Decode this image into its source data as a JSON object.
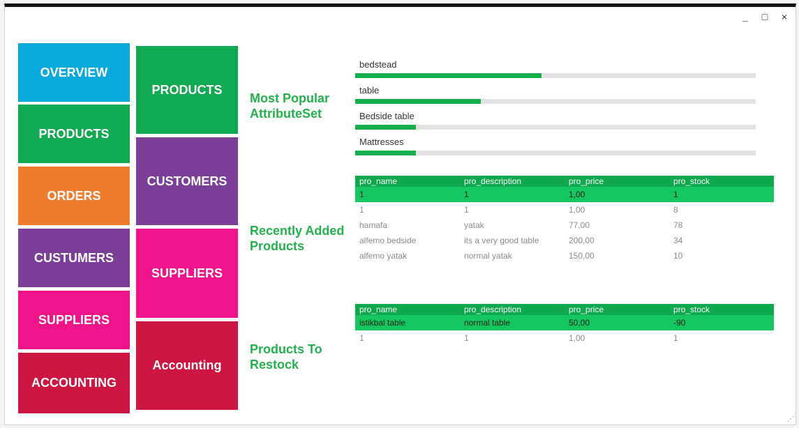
{
  "window": {
    "minimize": "_",
    "maximize": "□",
    "close": "×",
    "grip": "⋰"
  },
  "left_menu": [
    {
      "label": "OVERVIEW",
      "color": "#0aa9dd"
    },
    {
      "label": "PRODUCTS",
      "color": "#10a850"
    },
    {
      "label": "ORDERS",
      "color": "#f27c2e"
    },
    {
      "label": "CUSTUMERS",
      "color": "#7b3f98"
    },
    {
      "label": "SUPPLIERS",
      "color": "#f0148b"
    },
    {
      "label": "ACCOUNTING",
      "color": "#cc1540"
    }
  ],
  "right_menu": [
    {
      "label": "PRODUCTS",
      "color": "#10a850"
    },
    {
      "label": "CUSTOMERS",
      "color": "#7b3f98"
    },
    {
      "label": "SUPPLIERS",
      "color": "#f0148b"
    },
    {
      "label": "Accounting",
      "color": "#cc1540"
    }
  ],
  "sections": {
    "popular": "Most Popular AttributeSet",
    "recent": "Recently Added Products",
    "restock": "Products To Restock"
  },
  "popular_bars": [
    {
      "label": "bedstead",
      "fraction": 0.465
    },
    {
      "label": "table",
      "fraction": 0.313
    },
    {
      "label": "Bedside table",
      "fraction": 0.152
    },
    {
      "label": "Mattresses",
      "fraction": 0.152
    }
  ],
  "recent_table": {
    "headers": [
      "pro_name",
      "pro_description",
      "pro_price",
      "pro_stock"
    ],
    "rows": [
      [
        "1",
        "1",
        "1,00",
        "1"
      ],
      [
        "1",
        "1",
        "1,00",
        "8"
      ],
      [
        "hamafa",
        "yatak",
        "77,00",
        "78"
      ],
      [
        "alfemo bedside",
        "its a very good table",
        "200,00",
        "34"
      ],
      [
        "alfemo yatak",
        "normal yatak",
        "150,00",
        "10"
      ]
    ],
    "selected_row": 0
  },
  "restock_table": {
    "headers": [
      "pro_name",
      "pro_description",
      "pro_price",
      "pro_stock"
    ],
    "rows": [
      [
        "istikbal table",
        "normal table",
        "50,00",
        "-90"
      ],
      [
        "1",
        "1",
        "1,00",
        "1"
      ]
    ],
    "selected_row": 0
  },
  "colors": {
    "accent_green": "#22b14c",
    "header_green": "#0fa84c",
    "selected_green": "#14c75e"
  }
}
